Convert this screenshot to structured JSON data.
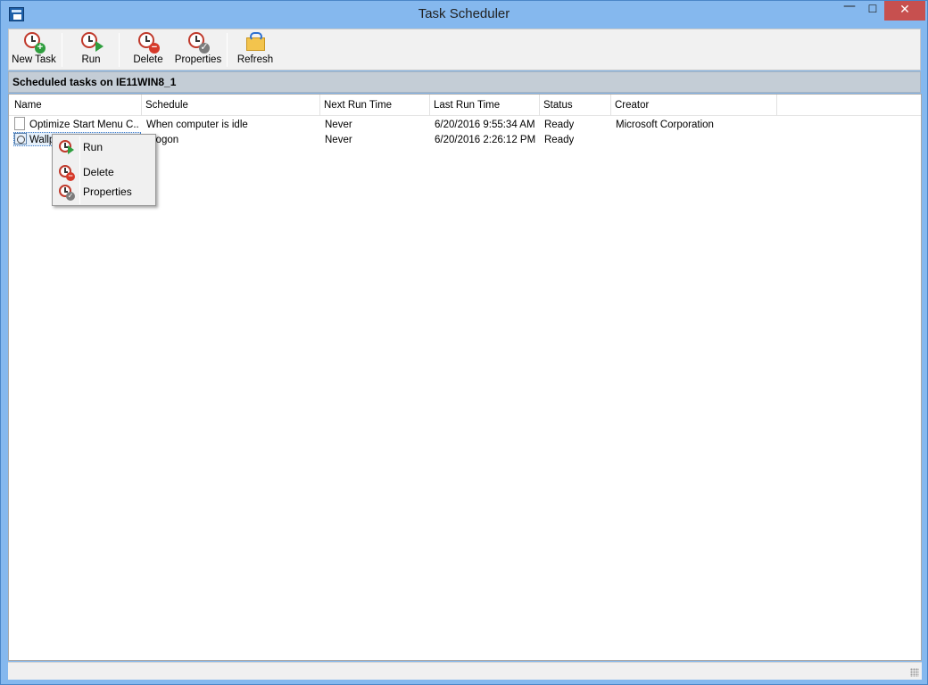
{
  "window": {
    "title": "Task Scheduler"
  },
  "controls": {
    "minimize": "—",
    "maximize": "☐",
    "close": "✕"
  },
  "toolbar": {
    "items": [
      {
        "label": "New Task",
        "icon": "new-task-icon"
      },
      {
        "label": "Run",
        "icon": "run-icon"
      },
      {
        "label": "Delete",
        "icon": "delete-icon"
      },
      {
        "label": "Properties",
        "icon": "properties-icon"
      },
      {
        "label": "Refresh",
        "icon": "refresh-icon"
      }
    ]
  },
  "header": {
    "text": "Scheduled tasks on IE11WIN8_1"
  },
  "table": {
    "columns": [
      "Name",
      "Schedule",
      "Next Run Time",
      "Last Run Time",
      "Status",
      "Creator"
    ],
    "rows": [
      {
        "name": "Optimize Start Menu C...",
        "schedule": "When computer is idle",
        "next": "Never",
        "last": "6/20/2016 9:55:34 AM",
        "status": "Ready",
        "creator": "Microsoft Corporation"
      },
      {
        "name": "Wallp",
        "schedule": "logon",
        "next": "Never",
        "last": "6/20/2016 2:26:12 PM",
        "status": "Ready",
        "creator": ""
      }
    ]
  },
  "context_menu": {
    "items": [
      {
        "label": "Run",
        "icon": "run-icon"
      },
      {
        "label": "Delete",
        "icon": "delete-icon"
      },
      {
        "label": "Properties",
        "icon": "properties-icon"
      }
    ]
  }
}
